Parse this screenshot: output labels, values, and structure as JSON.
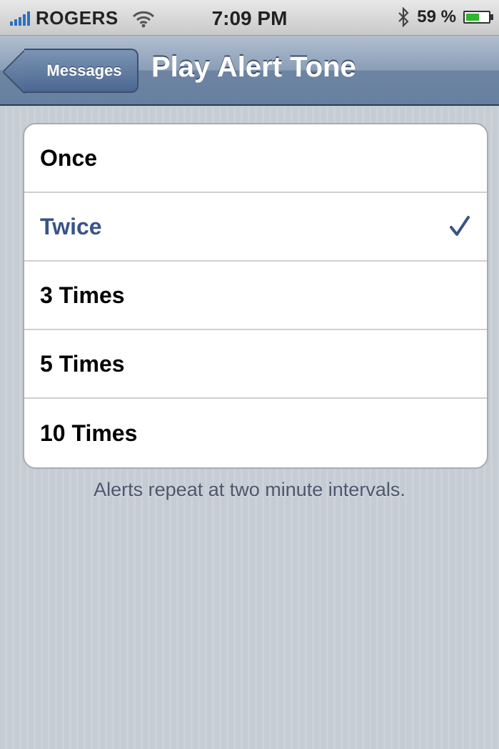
{
  "status_bar": {
    "carrier": "ROGERS",
    "time": "7:09 PM",
    "battery": "59 %",
    "battery_level": 0.59,
    "icons": [
      "signal-icon",
      "wifi-icon",
      "bluetooth-icon",
      "battery-icon"
    ]
  },
  "nav": {
    "back_label": "Messages",
    "title": "Play Alert Tone"
  },
  "options": [
    {
      "label": "Once",
      "selected": false
    },
    {
      "label": "Twice",
      "selected": true
    },
    {
      "label": "3 Times",
      "selected": false
    },
    {
      "label": "5 Times",
      "selected": false
    },
    {
      "label": "10 Times",
      "selected": false
    }
  ],
  "footer": "Alerts repeat at two minute intervals.",
  "colors": {
    "selected_text": "#385487",
    "navbar": "#6d84a2",
    "background": "#c5ccd4"
  }
}
